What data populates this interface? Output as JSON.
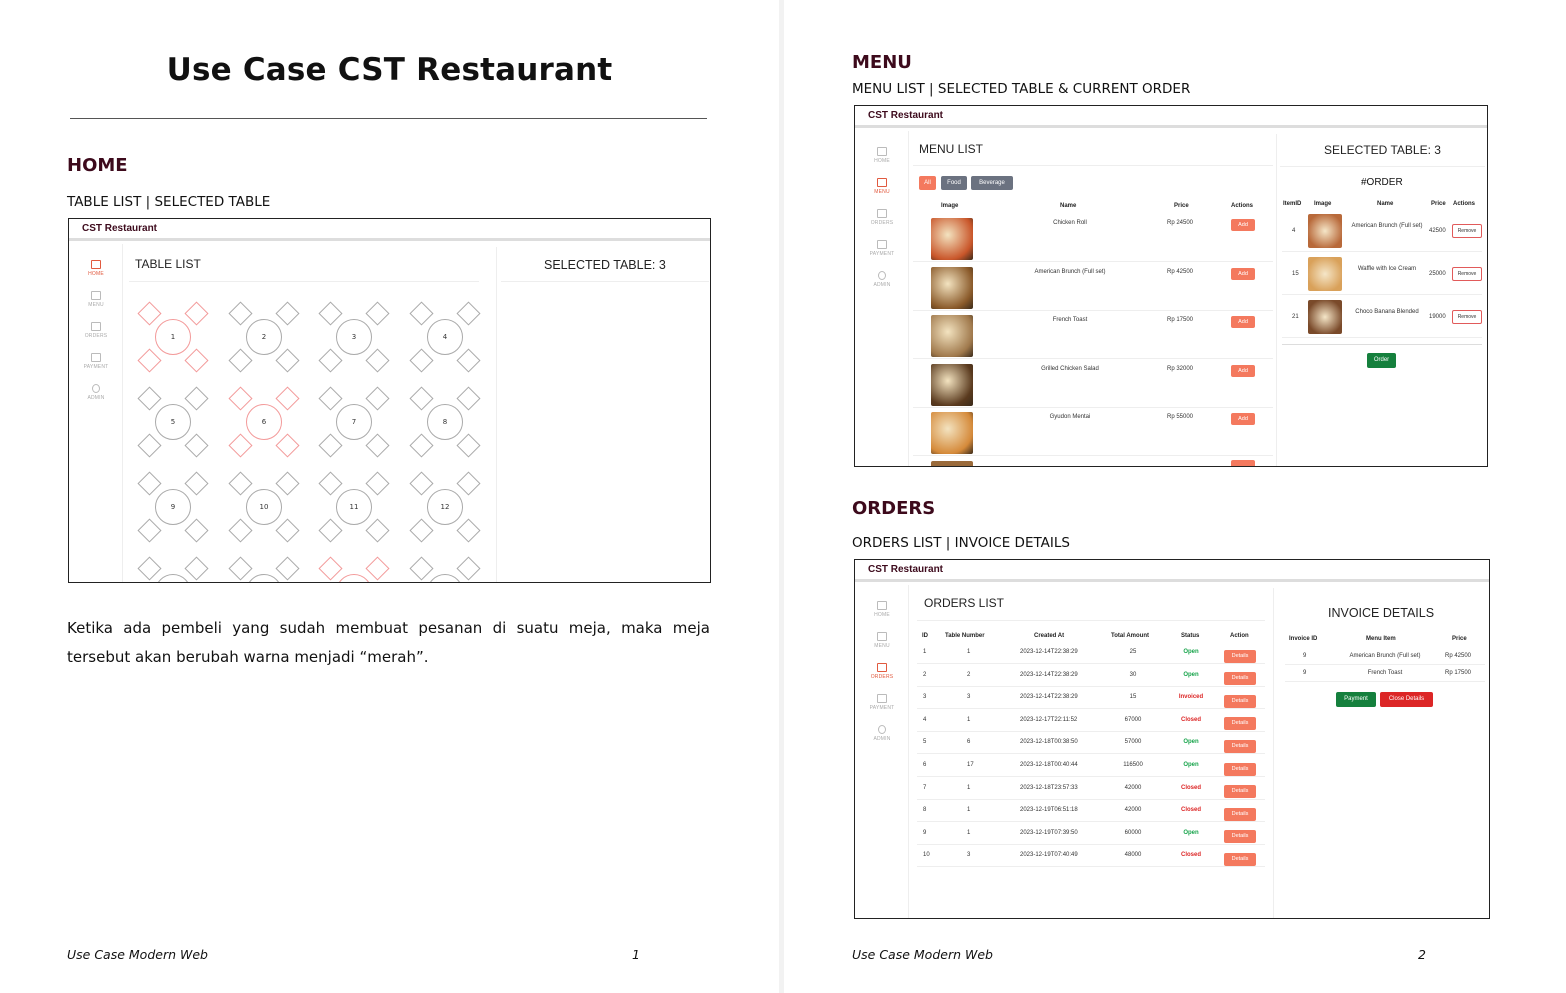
{
  "page1": {
    "doc_title": "Use Case CST Restaurant",
    "section": "HOME",
    "subtitle": "TABLE LIST | SELECTED TABLE",
    "app": {
      "brand": "CST Restaurant",
      "nav": [
        "HOME",
        "MENU",
        "ORDERS",
        "PAYMENT",
        "ADMIN"
      ],
      "active_nav": "HOME",
      "table_list_title": "TABLE LIST",
      "selected_table": "SELECTED TABLE: 3",
      "tables": [
        "1",
        "2",
        "3",
        "4",
        "5",
        "6",
        "7",
        "8",
        "9",
        "10",
        "11",
        "12"
      ]
    },
    "paragraph": "Ketika ada pembeli yang sudah membuat pesanan di suatu meja, maka meja tersebut akan berubah warna menjadi “merah”.",
    "footer": "Use Case Modern Web",
    "page_number": "1"
  },
  "page2": {
    "menu_section": "MENU",
    "menu_subtitle": "MENU LIST | SELECTED TABLE & CURRENT ORDER",
    "menu_app": {
      "brand": "CST Restaurant",
      "nav": [
        "HOME",
        "MENU",
        "ORDERS",
        "PAYMENT",
        "ADMIN"
      ],
      "menu_list_title": "MENU LIST",
      "filters": [
        "All",
        "Food",
        "Beverage"
      ],
      "columns": [
        "Image",
        "Name",
        "Price",
        "Actions"
      ],
      "add_label": "Add",
      "items": [
        {
          "name": "Chicken Roll",
          "price": "Rp 24500"
        },
        {
          "name": "American Brunch (Full set)",
          "price": "Rp 42500"
        },
        {
          "name": "French Toast",
          "price": "Rp 17500"
        },
        {
          "name": "Grilled Chicken Salad",
          "price": "Rp 32000"
        },
        {
          "name": "Gyudon Mentai",
          "price": "Rp 55000"
        }
      ],
      "selected_table": "SELECTED TABLE: 3",
      "order_title": "#ORDER",
      "order_columns": [
        "ItemID",
        "Image",
        "Name",
        "Price",
        "Actions"
      ],
      "order_rows": [
        {
          "id": "4",
          "name": "American Brunch (Full set)",
          "price": "42500"
        },
        {
          "id": "15",
          "name": "Waffle with Ice Cream",
          "price": "25000"
        },
        {
          "id": "21",
          "name": "Choco Banana Blended",
          "price": "19000"
        }
      ],
      "remove_label": "Remove",
      "order_button": "Order"
    },
    "orders_section": "ORDERS",
    "orders_subtitle": "ORDERS LIST | INVOICE DETAILS",
    "orders_app": {
      "brand": "CST Restaurant",
      "nav": [
        "HOME",
        "MENU",
        "ORDERS",
        "PAYMENT",
        "ADMIN"
      ],
      "orders_title": "ORDERS LIST",
      "columns": [
        "ID",
        "Table Number",
        "Created At",
        "Total Amount",
        "Status",
        "Action"
      ],
      "details_label": "Details",
      "rows": [
        {
          "id": "1",
          "table": "1",
          "created": "2023-12-14T22:38:29",
          "total": "25",
          "status": "Open"
        },
        {
          "id": "2",
          "table": "2",
          "created": "2023-12-14T22:38:29",
          "total": "30",
          "status": "Open"
        },
        {
          "id": "3",
          "table": "3",
          "created": "2023-12-14T22:38:29",
          "total": "15",
          "status": "Invoiced"
        },
        {
          "id": "4",
          "table": "1",
          "created": "2023-12-17T22:11:52",
          "total": "67000",
          "status": "Closed"
        },
        {
          "id": "5",
          "table": "6",
          "created": "2023-12-18T00:38:50",
          "total": "57000",
          "status": "Open"
        },
        {
          "id": "6",
          "table": "17",
          "created": "2023-12-18T00:40:44",
          "total": "116500",
          "status": "Open"
        },
        {
          "id": "7",
          "table": "1",
          "created": "2023-12-18T23:57:33",
          "total": "42000",
          "status": "Closed"
        },
        {
          "id": "8",
          "table": "1",
          "created": "2023-12-19T06:51:18",
          "total": "42000",
          "status": "Closed"
        },
        {
          "id": "9",
          "table": "1",
          "created": "2023-12-19T07:39:50",
          "total": "60000",
          "status": "Open"
        },
        {
          "id": "10",
          "table": "3",
          "created": "2023-12-19T07:40:49",
          "total": "48000",
          "status": "Closed"
        }
      ],
      "invoice_title": "INVOICE DETAILS",
      "invoice_columns": [
        "Invoice ID",
        "Menu Item",
        "Price"
      ],
      "invoice_rows": [
        {
          "id": "9",
          "item": "American Brunch (Full set)",
          "price": "Rp 42500"
        },
        {
          "id": "9",
          "item": "French Toast",
          "price": "Rp 17500"
        }
      ],
      "payment_button": "Payment",
      "close_button": "Close Details"
    },
    "footer": "Use Case Modern Web",
    "page_number": "2"
  },
  "colors": {
    "heading": "#3d0a1c",
    "accent": "#f4795e",
    "open": "#16a34a",
    "closed": "#dc2626",
    "order_btn": "#15803d",
    "busy_table": "#f39a9a"
  }
}
